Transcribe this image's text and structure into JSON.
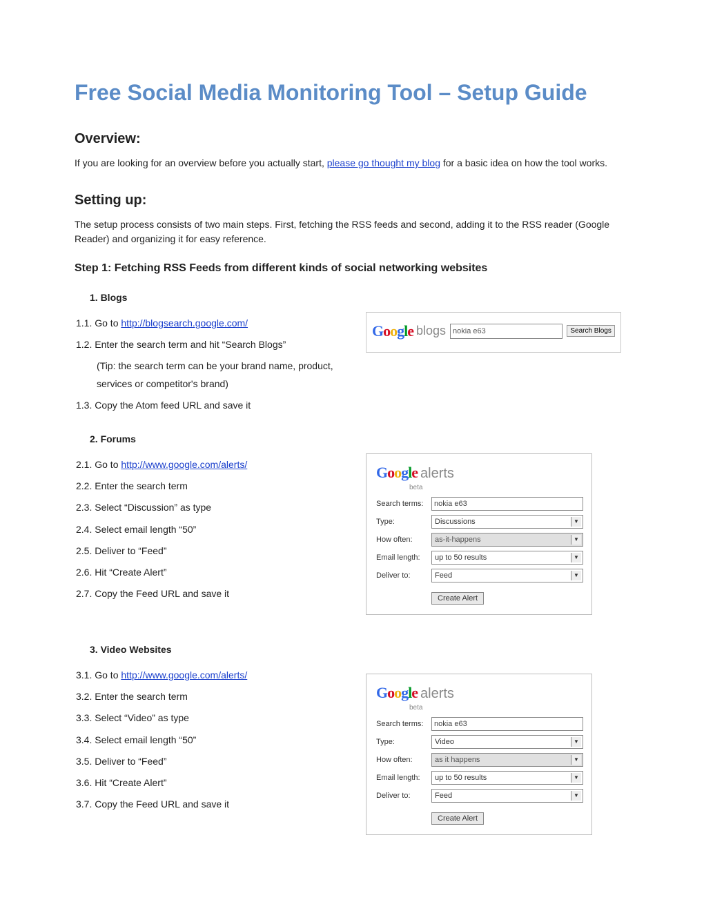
{
  "title": "Free Social Media Monitoring Tool – Setup Guide",
  "overview": {
    "heading": "Overview:",
    "text_before_link": "If you are looking for an overview before you actually start, ",
    "link_text": "please go thought my blog",
    "text_after_link": " for a basic idea on how the tool works."
  },
  "setting_up": {
    "heading": "Setting up:",
    "intro": "The setup process consists of two main steps. First, fetching the RSS feeds and second, adding it to the RSS reader (Google Reader) and organizing it for easy reference.",
    "step1_heading": "Step 1: Fetching RSS Feeds from different kinds of social networking websites"
  },
  "sections": {
    "blogs": {
      "label": "1.   Blogs",
      "items": {
        "i1_pre": "1.1. Go to ",
        "i1_link": "http://blogsearch.google.com/",
        "i2": "1.2. Enter the search term and hit “Search Blogs”",
        "i2_tip": "(Tip: the search term can be your brand name, product, services or competitor's brand)",
        "i3": "1.3. Copy the Atom feed URL and save it"
      },
      "widget": {
        "blogs_label": "blogs",
        "search_value": "nokia e63",
        "button": "Search Blogs"
      }
    },
    "forums": {
      "label": "2.   Forums",
      "items": {
        "i1_pre": "2.1. Go to ",
        "i1_link": "http://www.google.com/alerts/",
        "i2": "2.2. Enter the search term",
        "i3": "2.3. Select “Discussion” as type",
        "i4": "2.4. Select email length “50”",
        "i5": "2.5. Deliver to “Feed”",
        "i6": "2.6. Hit “Create Alert”",
        "i7": "2.7. Copy the Feed URL and save it"
      },
      "widget": {
        "alerts_label": "alerts",
        "beta": "beta",
        "labels": {
          "search": "Search terms:",
          "type": "Type:",
          "how": "How often:",
          "len": "Email length:",
          "deliver": "Deliver to:"
        },
        "values": {
          "search": "nokia e63",
          "type": "Discussions",
          "how": "as-it-happens",
          "len": "up to 50 results",
          "deliver": "Feed"
        },
        "button": "Create Alert"
      }
    },
    "video": {
      "label": "3.   Video Websites",
      "items": {
        "i1_pre": "3.1. Go to ",
        "i1_link": "http://www.google.com/alerts/",
        "i2": "3.2. Enter the search term",
        "i3": "3.3. Select “Video” as type",
        "i4": "3.4. Select email length “50”",
        "i5": "3.5. Deliver to “Feed”",
        "i6": "3.6. Hit “Create Alert”",
        "i7": "3.7. Copy the Feed URL and save it"
      },
      "widget": {
        "alerts_label": "alerts",
        "beta": "beta",
        "labels": {
          "search": "Search terms:",
          "type": "Type:",
          "how": "How often:",
          "len": "Email length:",
          "deliver": "Deliver to:"
        },
        "values": {
          "search": "nokia e63",
          "type": "Video",
          "how": "as it happens",
          "len": "up to 50 results",
          "deliver": "Feed"
        },
        "button": "Create Alert"
      }
    }
  }
}
